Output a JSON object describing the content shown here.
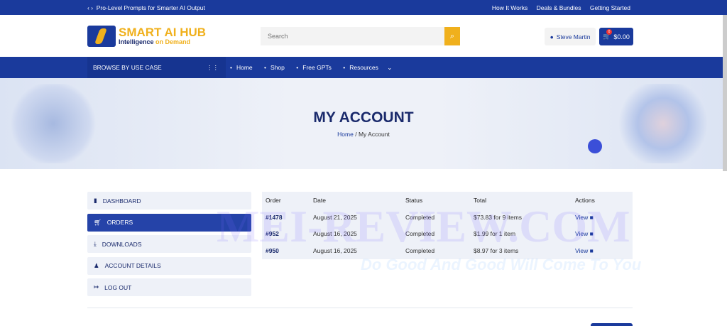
{
  "topbar": {
    "promo": "Pro-Level Prompts for Smarter AI Output",
    "links": [
      "How It Works",
      "Deals & Bundles",
      "Getting Started"
    ]
  },
  "header": {
    "logo_title": "SMART AI HUB",
    "logo_tag1": "Intelligence",
    "logo_tag2": "on Demand",
    "search_placeholder": "Search",
    "user": "Steve Martin",
    "cart_total": "$0.00",
    "cart_count": "0"
  },
  "nav": {
    "browse": "BROWSE BY USE CASE",
    "items": [
      "Home",
      "Shop",
      "Free GPTs",
      "Resources"
    ]
  },
  "hero": {
    "title": "MY ACCOUNT",
    "crumb_home": "Home",
    "crumb_sep": "/",
    "crumb_current": "My Account"
  },
  "sidebar": {
    "items": [
      {
        "label": "DASHBOARD",
        "icon": "bookmark-icon"
      },
      {
        "label": "ORDERS",
        "icon": "cart-icon",
        "active": true
      },
      {
        "label": "DOWNLOADS",
        "icon": "download-icon"
      },
      {
        "label": "ACCOUNT DETAILS",
        "icon": "user-icon"
      },
      {
        "label": "LOG OUT",
        "icon": "logout-icon"
      }
    ]
  },
  "orders": {
    "headers": [
      "Order",
      "Date",
      "Status",
      "Total",
      "Actions"
    ],
    "rows": [
      {
        "order": "#1478",
        "date": "August 21, 2025",
        "status": "Completed",
        "total": "$73.83 for 9 items",
        "action": "View"
      },
      {
        "order": "#952",
        "date": "August 16, 2025",
        "status": "Completed",
        "total": "$1.99 for 1 item",
        "action": "View"
      },
      {
        "order": "#950",
        "date": "August 16, 2025",
        "status": "Completed",
        "total": "$8.97 for 3 items",
        "action": "View"
      }
    ]
  },
  "watermark": {
    "main": "MEI-REVIEW.COM",
    "tagline": "Do Good And Good Will Come To You"
  },
  "colors": {
    "primary": "#1a3a9c",
    "accent": "#f0b01c"
  }
}
